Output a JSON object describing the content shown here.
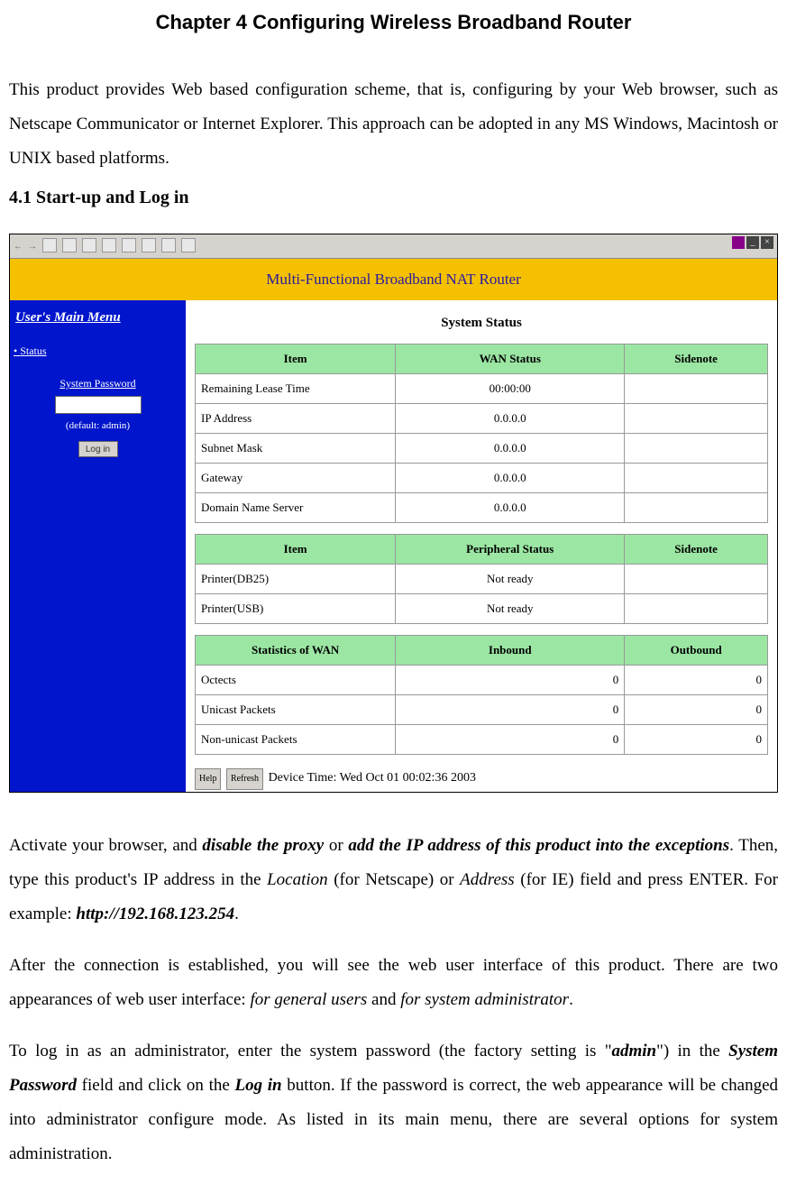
{
  "chapter": "Chapter 4    Configuring Wireless Broadband Router",
  "intro": "This product provides Web based configuration scheme, that is, configuring by your Web browser, such as Netscape Communicator or Internet Explorer. This approach can be adopted in any MS Windows, Macintosh or UNIX based platforms.",
  "section": "4.1 Start-up and Log in",
  "screenshot": {
    "banner": "Multi-Functional Broadband NAT Router",
    "sidebar": {
      "menu_title": "User's Main Menu",
      "status": "Status",
      "pw_label": "System Password",
      "default_note": "(default: admin)",
      "login": "Log in"
    },
    "content": {
      "title": "System Status",
      "t1": {
        "h1": "Item",
        "h2": "WAN Status",
        "h3": "Sidenote",
        "rows": [
          {
            "a": "Remaining Lease Time",
            "b": "00:00:00",
            "c": ""
          },
          {
            "a": "IP Address",
            "b": "0.0.0.0",
            "c": ""
          },
          {
            "a": "Subnet Mask",
            "b": "0.0.0.0",
            "c": ""
          },
          {
            "a": "Gateway",
            "b": "0.0.0.0",
            "c": ""
          },
          {
            "a": "Domain Name Server",
            "b": "0.0.0.0",
            "c": ""
          }
        ]
      },
      "t2": {
        "h1": "Item",
        "h2": "Peripheral Status",
        "h3": "Sidenote",
        "rows": [
          {
            "a": "Printer(DB25)",
            "b": "Not ready",
            "c": ""
          },
          {
            "a": "Printer(USB)",
            "b": "Not ready",
            "c": ""
          }
        ]
      },
      "t3": {
        "h1": "Statistics of WAN",
        "h2": "Inbound",
        "h3": "Outbound",
        "rows": [
          {
            "a": "Octects",
            "b": "0",
            "c": "0"
          },
          {
            "a": "Unicast Packets",
            "b": "0",
            "c": "0"
          },
          {
            "a": "Non-unicast Packets",
            "b": "0",
            "c": "0"
          }
        ]
      },
      "help": "Help",
      "refresh": "Refresh",
      "device_time": "Device Time: Wed Oct 01 00:02:36 2003"
    }
  },
  "body": {
    "p1_a": "Activate your browser, and ",
    "p1_b": "disable the proxy",
    "p1_c": " or ",
    "p1_d": "add the IP address of this product into the exceptions",
    "p1_e": ". Then, type this product's IP address in the ",
    "p1_f": "Location",
    "p1_g": " (for Netscape) or ",
    "p1_h": "Address",
    "p1_i": " (for IE) field and press ENTER. For example: ",
    "p1_j": "http://192.168.123.254",
    "p1_k": ".",
    "p2_a": "After the connection is established, you will see the web user interface of this product. There are two appearances of web user interface: ",
    "p2_b": "for general users",
    "p2_c": " and ",
    "p2_d": "for system administrator",
    "p2_e": ".",
    "p3_a": "To log in as an administrator, enter the system password (the factory setting is \"",
    "p3_b": "admin",
    "p3_c": "\") in the ",
    "p3_d": "System Password",
    "p3_e": " field and click on the ",
    "p3_f": "Log in",
    "p3_g": " button. If the password is correct, the web appearance will be changed into administrator configure mode. As listed in its main menu, there are several options for system administration."
  }
}
